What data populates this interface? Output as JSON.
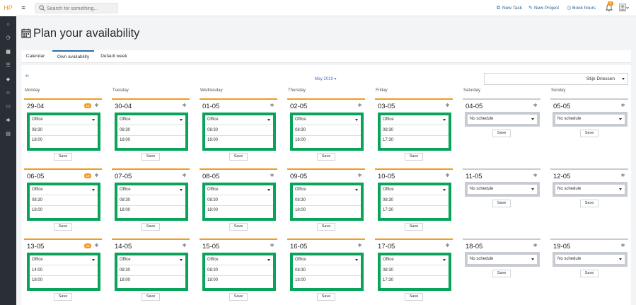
{
  "app": {
    "logo": "HP"
  },
  "topbar": {
    "search_placeholder": "Search for something...",
    "links": [
      {
        "label": "New Task",
        "icon": "external-link-icon"
      },
      {
        "label": "New Project",
        "icon": "tag-icon"
      },
      {
        "label": "Book hours",
        "icon": "clock-icon"
      }
    ],
    "notification_count": "0"
  },
  "sidebar": {
    "items": [
      "home-icon",
      "clock-icon",
      "calendar-icon",
      "list-icon",
      "tag-icon",
      "users-icon",
      "contact-card-icon",
      "gear-icon",
      "book-icon"
    ],
    "active": 2
  },
  "page": {
    "title": "Plan your availability"
  },
  "tabs": [
    {
      "label": "Calendar",
      "active": false
    },
    {
      "label": "Own availability",
      "active": true
    },
    {
      "label": "Default week",
      "active": false
    }
  ],
  "calendar": {
    "month": "May 2019 ▾",
    "user": "Stijn Driessen",
    "day_names": [
      "Monday",
      "Tuesday",
      "Wednesday",
      "Thursday",
      "Friday",
      "Saturday",
      "Sunday"
    ],
    "weekend_option": "No schedule",
    "save_label": "Save",
    "weeks": [
      {
        "badge": "18",
        "days": [
          {
            "date": "29-04",
            "loc": "Office",
            "start": "08:30",
            "end": "18:00"
          },
          {
            "date": "30-04",
            "loc": "Office",
            "start": "08:30",
            "end": "18:00"
          },
          {
            "date": "01-05",
            "loc": "Office",
            "start": "08:30",
            "end": "18:00"
          },
          {
            "date": "02-05",
            "loc": "Office",
            "start": "08:30",
            "end": "18:00"
          },
          {
            "date": "03-05",
            "loc": "Office",
            "start": "08:30",
            "end": "17:30"
          },
          {
            "date": "04-05"
          },
          {
            "date": "05-05"
          }
        ]
      },
      {
        "badge": "19",
        "days": [
          {
            "date": "06-05",
            "loc": "Office",
            "start": "08:30",
            "end": "18:00"
          },
          {
            "date": "07-05",
            "loc": "Office",
            "start": "08:30",
            "end": "18:00"
          },
          {
            "date": "08-05",
            "loc": "Office",
            "start": "08:30",
            "end": "18:00"
          },
          {
            "date": "09-05",
            "loc": "Office",
            "start": "08:30",
            "end": "18:00"
          },
          {
            "date": "10-05",
            "loc": "Office",
            "start": "08:30",
            "end": "17:30"
          },
          {
            "date": "11-05"
          },
          {
            "date": "12-05"
          }
        ]
      },
      {
        "badge": "20",
        "days": [
          {
            "date": "13-05",
            "loc": "Office",
            "start": "14:00",
            "end": "18:00"
          },
          {
            "date": "14-05",
            "loc": "Office",
            "start": "08:30",
            "end": "18:00"
          },
          {
            "date": "15-05",
            "loc": "Office",
            "start": "08:30",
            "end": "18:00"
          },
          {
            "date": "16-05",
            "loc": "Office",
            "start": "08:30",
            "end": "18:00"
          },
          {
            "date": "17-05",
            "loc": "Office",
            "start": "08:30",
            "end": "17:30"
          },
          {
            "date": "18-05"
          },
          {
            "date": "19-05"
          }
        ]
      }
    ]
  },
  "colors": {
    "accent": "#f39a1f",
    "highlight": "#0aa35a",
    "link": "#2c6ea8",
    "sidebar": "#2a2f36"
  }
}
